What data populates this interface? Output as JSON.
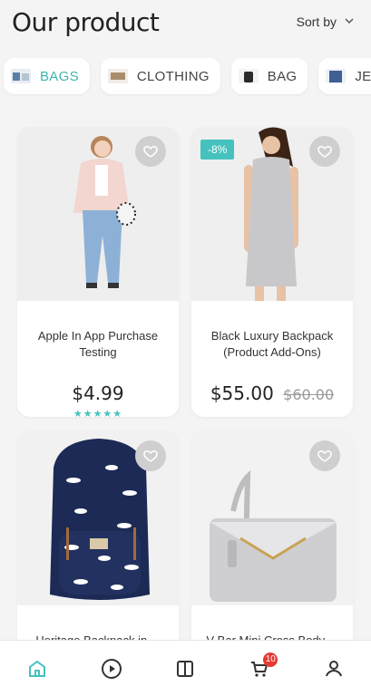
{
  "header": {
    "title": "Our product",
    "sort_label": "Sort by"
  },
  "categories": [
    {
      "label": "BAGS",
      "active": true
    },
    {
      "label": "CLOTHING",
      "active": false
    },
    {
      "label": "BAG",
      "active": false
    },
    {
      "label": "JEANS",
      "active": false
    }
  ],
  "products": [
    {
      "name": "Apple In App Purchase Testing",
      "price": "$4.99",
      "rating": "★★★★★"
    },
    {
      "name": "Black Luxury Backpack (Product Add-Ons)",
      "price": "$55.00",
      "old_price": "$60.00",
      "discount": "-8%"
    },
    {
      "name": "Heritage Backpack in ..."
    },
    {
      "name": "V Bar Mini Cross Body ..."
    }
  ],
  "bottom_nav": {
    "cart_count": "10"
  },
  "colors": {
    "accent": "#45c2bd",
    "badge": "#e53935"
  }
}
